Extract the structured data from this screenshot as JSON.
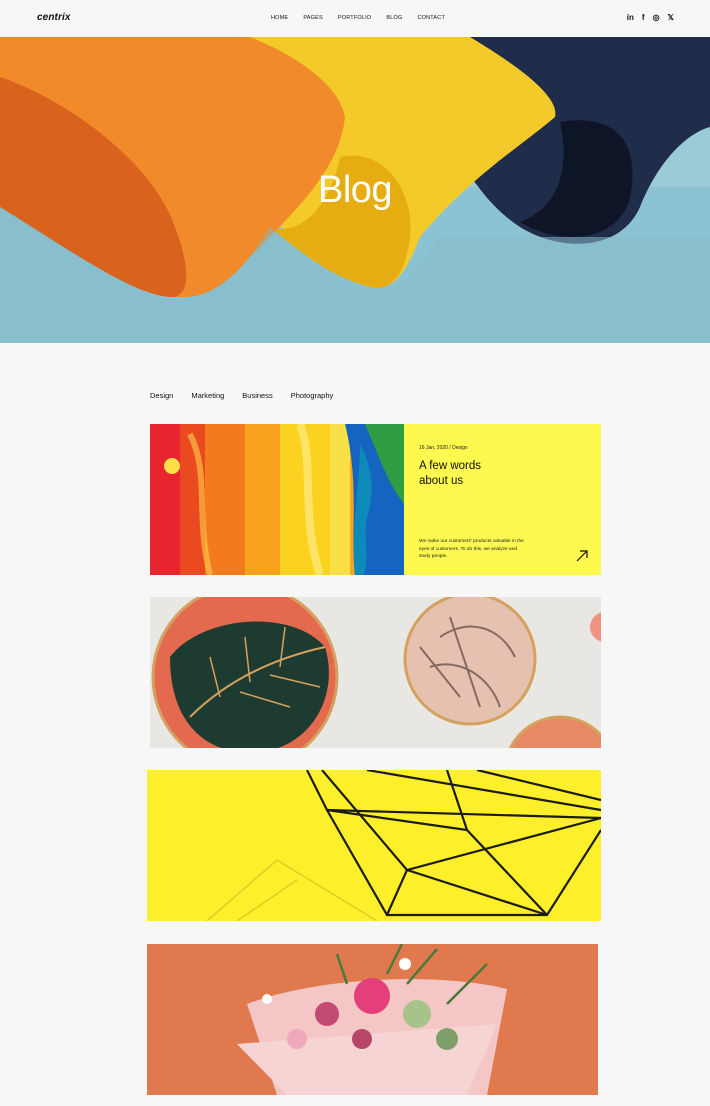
{
  "header": {
    "logo": "centrix",
    "nav": [
      "HOME",
      "PAGES",
      "PORTFOLIO",
      "BLOG",
      "CONTACT"
    ],
    "social": [
      {
        "icon": "linkedin-icon",
        "glyph": "in"
      },
      {
        "icon": "facebook-icon",
        "glyph": "f"
      },
      {
        "icon": "instagram-icon",
        "glyph": "◎"
      },
      {
        "icon": "twitter-icon",
        "glyph": "𝕏"
      }
    ]
  },
  "hero": {
    "title": "Blog"
  },
  "categories": [
    "Design",
    "Marketing",
    "Business",
    "Photography"
  ],
  "posts": [
    {
      "meta": "16 Jan, 2020 / Design",
      "title": "A few words about us",
      "excerpt": "We make our customers’ products valuable in the eyes of customers. To do this, we analyze and study people.",
      "accent": "#fdf94f"
    }
  ],
  "colors": {
    "background": "#f7f7f7",
    "hero_sky": "#8fc3d2",
    "orange": "#f08a2a",
    "yellow": "#f4c92a",
    "navy": "#1f2c4a"
  }
}
